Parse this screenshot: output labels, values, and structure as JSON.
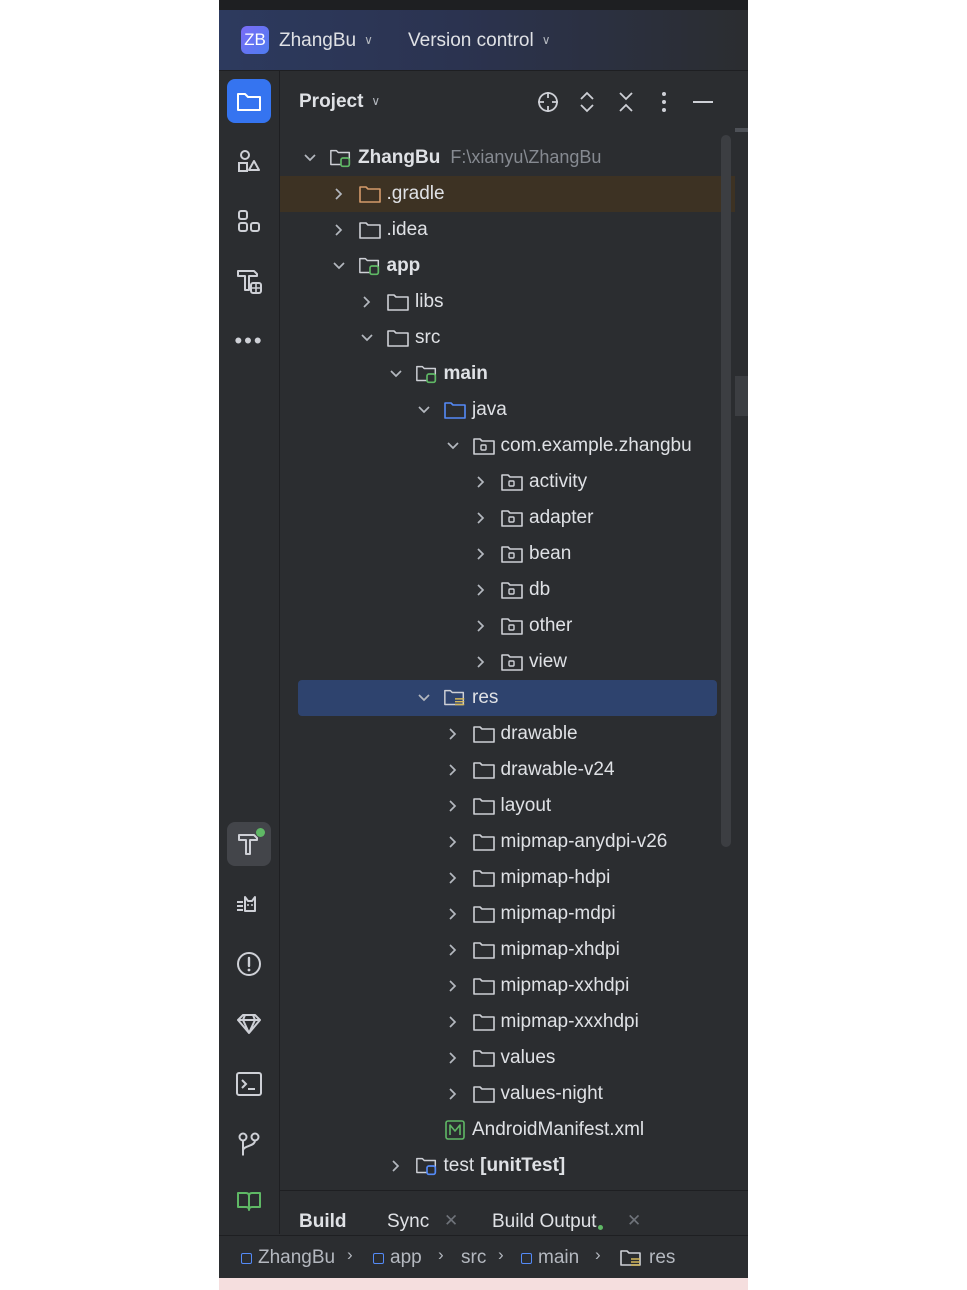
{
  "titlebar": {
    "badge": "ZB",
    "project_name": "ZhangBu",
    "vcs_label": "Version control"
  },
  "panel": {
    "title": "Project"
  },
  "tree": [
    {
      "label": "ZhangBu",
      "path": "F:\\xianyu\\ZhangBu",
      "depth": 0,
      "expanded": true,
      "icon": "module-folder-icon",
      "bold": true
    },
    {
      "label": ".gradle",
      "depth": 1,
      "expanded": false,
      "icon": "folder-orange-icon",
      "git": true
    },
    {
      "label": ".idea",
      "depth": 1,
      "expanded": false,
      "icon": "folder-icon"
    },
    {
      "label": "app",
      "depth": 1,
      "expanded": true,
      "icon": "module-folder-icon",
      "bold": true
    },
    {
      "label": "libs",
      "depth": 2,
      "expanded": false,
      "icon": "folder-icon"
    },
    {
      "label": "src",
      "depth": 2,
      "expanded": true,
      "icon": "folder-icon"
    },
    {
      "label": "main",
      "depth": 3,
      "expanded": true,
      "icon": "module-folder-icon",
      "bold": true
    },
    {
      "label": "java",
      "depth": 4,
      "expanded": true,
      "icon": "source-folder-icon"
    },
    {
      "label": "com.example.zhangbu",
      "depth": 5,
      "expanded": true,
      "icon": "package-icon"
    },
    {
      "label": "activity",
      "depth": 6,
      "expanded": false,
      "icon": "package-icon"
    },
    {
      "label": "adapter",
      "depth": 6,
      "expanded": false,
      "icon": "package-icon"
    },
    {
      "label": "bean",
      "depth": 6,
      "expanded": false,
      "icon": "package-icon"
    },
    {
      "label": "db",
      "depth": 6,
      "expanded": false,
      "icon": "package-icon"
    },
    {
      "label": "other",
      "depth": 6,
      "expanded": false,
      "icon": "package-icon"
    },
    {
      "label": "view",
      "depth": 6,
      "expanded": false,
      "icon": "package-icon"
    },
    {
      "label": "res",
      "depth": 4,
      "expanded": true,
      "icon": "resources-folder-icon",
      "selected": true
    },
    {
      "label": "drawable",
      "depth": 5,
      "expanded": false,
      "icon": "folder-icon"
    },
    {
      "label": "drawable-v24",
      "depth": 5,
      "expanded": false,
      "icon": "folder-icon"
    },
    {
      "label": "layout",
      "depth": 5,
      "expanded": false,
      "icon": "folder-icon"
    },
    {
      "label": "mipmap-anydpi-v26",
      "depth": 5,
      "expanded": false,
      "icon": "folder-icon"
    },
    {
      "label": "mipmap-hdpi",
      "depth": 5,
      "expanded": false,
      "icon": "folder-icon"
    },
    {
      "label": "mipmap-mdpi",
      "depth": 5,
      "expanded": false,
      "icon": "folder-icon"
    },
    {
      "label": "mipmap-xhdpi",
      "depth": 5,
      "expanded": false,
      "icon": "folder-icon"
    },
    {
      "label": "mipmap-xxhdpi",
      "depth": 5,
      "expanded": false,
      "icon": "folder-icon"
    },
    {
      "label": "mipmap-xxxhdpi",
      "depth": 5,
      "expanded": false,
      "icon": "folder-icon"
    },
    {
      "label": "values",
      "depth": 5,
      "expanded": false,
      "icon": "folder-icon"
    },
    {
      "label": "values-night",
      "depth": 5,
      "expanded": false,
      "icon": "folder-icon"
    },
    {
      "label": "AndroidManifest.xml",
      "depth": 4,
      "leaf": true,
      "icon": "manifest-file-icon"
    },
    {
      "label": "test",
      "suffix": "[unitTest]",
      "depth": 3,
      "expanded": false,
      "icon": "test-folder-icon"
    }
  ],
  "bottom_tabs": {
    "build": "Build",
    "sync": "Sync",
    "build_output": "Build Output"
  },
  "breadcrumb": [
    "ZhangBu",
    "app",
    "src",
    "main",
    "res"
  ],
  "colors": {
    "accent": "#3574f0",
    "selection": "#2e436e",
    "module_green": "#5fb865",
    "package_blue": "#548af7",
    "git_ignored": "#d49a6a"
  }
}
